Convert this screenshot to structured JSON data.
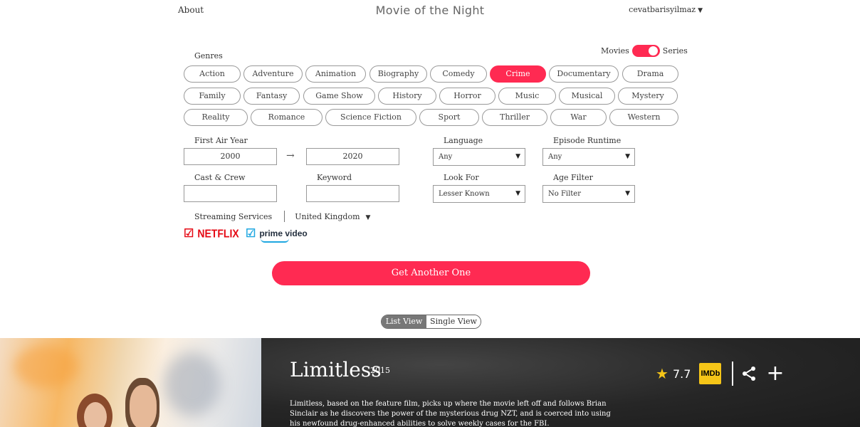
{
  "nav": {
    "about": "About",
    "title": "Movie of the Night",
    "user": "cevatbarisyilmaz"
  },
  "type_toggle": {
    "left_label": "Movies",
    "right_label": "Series",
    "selected": "Series"
  },
  "genres": {
    "label": "Genres",
    "items": [
      "Action",
      "Adventure",
      "Animation",
      "Biography",
      "Comedy",
      "Crime",
      "Documentary",
      "Drama",
      "Family",
      "Fantasy",
      "Game Show",
      "History",
      "Horror",
      "Music",
      "Musical",
      "Mystery",
      "Reality",
      "Romance",
      "Science Fiction",
      "Sport",
      "Thriller",
      "War",
      "Western"
    ],
    "selected": "Crime"
  },
  "filters": {
    "first_air_year_label": "First Air Year",
    "year_from": "2000",
    "year_to": "2020",
    "language_label": "Language",
    "language_value": "Any",
    "episode_runtime_label": "Episode Runtime",
    "episode_runtime_value": "Any",
    "cast_crew_label": "Cast & Crew",
    "cast_crew_value": "",
    "keyword_label": "Keyword",
    "keyword_value": "",
    "look_for_label": "Look For",
    "look_for_value": "Lesser Known",
    "age_filter_label": "Age Filter",
    "age_filter_value": "No Filter"
  },
  "streaming": {
    "label": "Streaming Services",
    "country": "United Kingdom",
    "services": [
      {
        "name": "NETFLIX",
        "checked": true,
        "check_color": "#e50914"
      },
      {
        "name": "prime video",
        "checked": true,
        "check_color": "#1ea7e1"
      }
    ]
  },
  "cta": "Get Another One",
  "view_switch": {
    "list": "List View",
    "single": "Single View",
    "selected": "List View"
  },
  "result": {
    "title": "Limitless",
    "year": "2015",
    "rating": "7.7",
    "imdb_label": "IMDb",
    "overview": "Limitless, based on the feature film, picks up where the movie left off and follows Brian Sinclair as he discovers the power of the mysterious drug NZT, and is coerced into using his newfound drug-enhanced abilities to solve weekly cases for the FBI."
  },
  "colors": {
    "accent": "#ff2a52",
    "imdb": "#f5c518",
    "netflix": "#e50914",
    "prime": "#1ea7e1"
  }
}
